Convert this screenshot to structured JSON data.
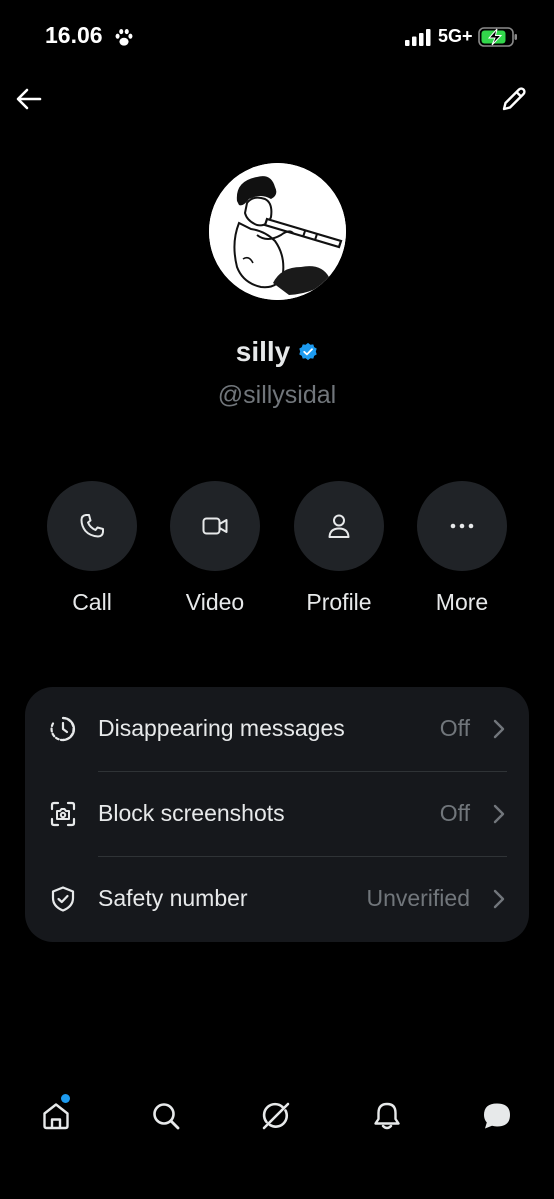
{
  "status_bar": {
    "time": "16.06",
    "network": "5G+",
    "icons": [
      "paw-icon",
      "signal-icon",
      "battery-charging-icon"
    ]
  },
  "header": {
    "back_icon": "arrow-left-icon",
    "edit_icon": "pencil-icon"
  },
  "profile": {
    "display_name": "silly",
    "handle": "@sillysidal",
    "verified": true,
    "verified_color": "#1d9bf0"
  },
  "actions": [
    {
      "label": "Call",
      "icon": "phone-icon"
    },
    {
      "label": "Video",
      "icon": "video-camera-icon"
    },
    {
      "label": "Profile",
      "icon": "person-icon"
    },
    {
      "label": "More",
      "icon": "more-dots-icon"
    }
  ],
  "settings": [
    {
      "label": "Disappearing messages",
      "value": "Off",
      "icon": "timer-icon"
    },
    {
      "label": "Block screenshots",
      "value": "Off",
      "icon": "camera-frame-icon"
    },
    {
      "label": "Safety number",
      "value": "Unverified",
      "icon": "shield-check-icon"
    }
  ],
  "bottom_nav": [
    {
      "name": "home",
      "icon": "home-icon",
      "has_dot": true
    },
    {
      "name": "search",
      "icon": "search-icon"
    },
    {
      "name": "grok",
      "icon": "grok-icon"
    },
    {
      "name": "notifications",
      "icon": "bell-icon"
    },
    {
      "name": "messages",
      "icon": "chat-bubble-icon",
      "active": true
    }
  ],
  "colors": {
    "background": "#000000",
    "card": "#16181c",
    "button": "#202327",
    "text": "#e7e9ea",
    "muted": "#71767b",
    "accent": "#1d9bf0"
  }
}
